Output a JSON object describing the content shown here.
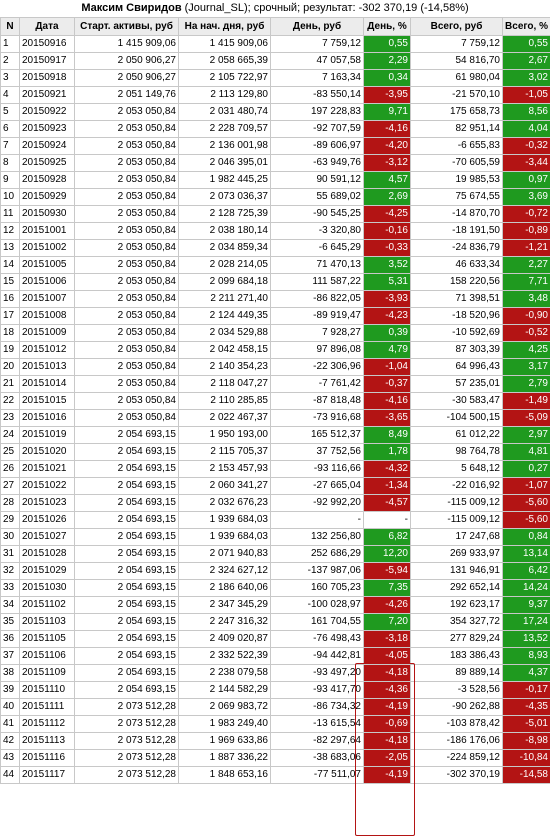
{
  "header": {
    "name": "Максим Свиридов",
    "rest": " (Journal_SL); срочный; результат: -302 370,19 (-14,58%)"
  },
  "columns": [
    "N",
    "Дата",
    "Старт. активы, руб",
    "На нач. дня, руб",
    "День, руб",
    "День, %",
    "Всего, руб",
    "Всего, %"
  ],
  "colors": {
    "positive": "#1f9a1f",
    "negative": "#b31414"
  },
  "rows": [
    [
      "1",
      "20150916",
      "1 415 909,06",
      "1 415 909,06",
      "7 759,12",
      "0,55",
      "7 759,12",
      "0,55"
    ],
    [
      "2",
      "20150917",
      "2 050 906,27",
      "2 058 665,39",
      "47 057,58",
      "2,29",
      "54 816,70",
      "2,67"
    ],
    [
      "3",
      "20150918",
      "2 050 906,27",
      "2 105 722,97",
      "7 163,34",
      "0,34",
      "61 980,04",
      "3,02"
    ],
    [
      "4",
      "20150921",
      "2 051 149,76",
      "2 113 129,80",
      "-83 550,14",
      "-3,95",
      "-21 570,10",
      "-1,05"
    ],
    [
      "5",
      "20150922",
      "2 053 050,84",
      "2 031 480,74",
      "197 228,83",
      "9,71",
      "175 658,73",
      "8,56"
    ],
    [
      "6",
      "20150923",
      "2 053 050,84",
      "2 228 709,57",
      "-92 707,59",
      "-4,16",
      "82 951,14",
      "4,04"
    ],
    [
      "7",
      "20150924",
      "2 053 050,84",
      "2 136 001,98",
      "-89 606,97",
      "-4,20",
      "-6 655,83",
      "-0,32"
    ],
    [
      "8",
      "20150925",
      "2 053 050,84",
      "2 046 395,01",
      "-63 949,76",
      "-3,12",
      "-70 605,59",
      "-3,44"
    ],
    [
      "9",
      "20150928",
      "2 053 050,84",
      "1 982 445,25",
      "90 591,12",
      "4,57",
      "19 985,53",
      "0,97"
    ],
    [
      "10",
      "20150929",
      "2 053 050,84",
      "2 073 036,37",
      "55 689,02",
      "2,69",
      "75 674,55",
      "3,69"
    ],
    [
      "11",
      "20150930",
      "2 053 050,84",
      "2 128 725,39",
      "-90 545,25",
      "-4,25",
      "-14 870,70",
      "-0,72"
    ],
    [
      "12",
      "20151001",
      "2 053 050,84",
      "2 038 180,14",
      "-3 320,80",
      "-0,16",
      "-18 191,50",
      "-0,89"
    ],
    [
      "13",
      "20151002",
      "2 053 050,84",
      "2 034 859,34",
      "-6 645,29",
      "-0,33",
      "-24 836,79",
      "-1,21"
    ],
    [
      "14",
      "20151005",
      "2 053 050,84",
      "2 028 214,05",
      "71 470,13",
      "3,52",
      "46 633,34",
      "2,27"
    ],
    [
      "15",
      "20151006",
      "2 053 050,84",
      "2 099 684,18",
      "111 587,22",
      "5,31",
      "158 220,56",
      "7,71"
    ],
    [
      "16",
      "20151007",
      "2 053 050,84",
      "2 211 271,40",
      "-86 822,05",
      "-3,93",
      "71 398,51",
      "3,48"
    ],
    [
      "17",
      "20151008",
      "2 053 050,84",
      "2 124 449,35",
      "-89 919,47",
      "-4,23",
      "-18 520,96",
      "-0,90"
    ],
    [
      "18",
      "20151009",
      "2 053 050,84",
      "2 034 529,88",
      "7 928,27",
      "0,39",
      "-10 592,69",
      "-0,52"
    ],
    [
      "19",
      "20151012",
      "2 053 050,84",
      "2 042 458,15",
      "97 896,08",
      "4,79",
      "87 303,39",
      "4,25"
    ],
    [
      "20",
      "20151013",
      "2 053 050,84",
      "2 140 354,23",
      "-22 306,96",
      "-1,04",
      "64 996,43",
      "3,17"
    ],
    [
      "21",
      "20151014",
      "2 053 050,84",
      "2 118 047,27",
      "-7 761,42",
      "-0,37",
      "57 235,01",
      "2,79"
    ],
    [
      "22",
      "20151015",
      "2 053 050,84",
      "2 110 285,85",
      "-87 818,48",
      "-4,16",
      "-30 583,47",
      "-1,49"
    ],
    [
      "23",
      "20151016",
      "2 053 050,84",
      "2 022 467,37",
      "-73 916,68",
      "-3,65",
      "-104 500,15",
      "-5,09"
    ],
    [
      "24",
      "20151019",
      "2 054 693,15",
      "1 950 193,00",
      "165 512,37",
      "8,49",
      "61 012,22",
      "2,97"
    ],
    [
      "25",
      "20151020",
      "2 054 693,15",
      "2 115 705,37",
      "37 752,56",
      "1,78",
      "98 764,78",
      "4,81"
    ],
    [
      "26",
      "20151021",
      "2 054 693,15",
      "2 153 457,93",
      "-93 116,66",
      "-4,32",
      "5 648,12",
      "0,27"
    ],
    [
      "27",
      "20151022",
      "2 054 693,15",
      "2 060 341,27",
      "-27 665,04",
      "-1,34",
      "-22 016,92",
      "-1,07"
    ],
    [
      "28",
      "20151023",
      "2 054 693,15",
      "2 032 676,23",
      "-92 992,20",
      "-4,57",
      "-115 009,12",
      "-5,60"
    ],
    [
      "29",
      "20151026",
      "2 054 693,15",
      "1 939 684,03",
      "-",
      "-",
      "-115 009,12",
      "-5,60"
    ],
    [
      "30",
      "20151027",
      "2 054 693,15",
      "1 939 684,03",
      "132 256,80",
      "6,82",
      "17 247,68",
      "0,84"
    ],
    [
      "31",
      "20151028",
      "2 054 693,15",
      "2 071 940,83",
      "252 686,29",
      "12,20",
      "269 933,97",
      "13,14"
    ],
    [
      "32",
      "20151029",
      "2 054 693,15",
      "2 324 627,12",
      "-137 987,06",
      "-5,94",
      "131 946,91",
      "6,42"
    ],
    [
      "33",
      "20151030",
      "2 054 693,15",
      "2 186 640,06",
      "160 705,23",
      "7,35",
      "292 652,14",
      "14,24"
    ],
    [
      "34",
      "20151102",
      "2 054 693,15",
      "2 347 345,29",
      "-100 028,97",
      "-4,26",
      "192 623,17",
      "9,37"
    ],
    [
      "35",
      "20151103",
      "2 054 693,15",
      "2 247 316,32",
      "161 704,55",
      "7,20",
      "354 327,72",
      "17,24"
    ],
    [
      "36",
      "20151105",
      "2 054 693,15",
      "2 409 020,87",
      "-76 498,43",
      "-3,18",
      "277 829,24",
      "13,52"
    ],
    [
      "37",
      "20151106",
      "2 054 693,15",
      "2 332 522,39",
      "-94 442,81",
      "-4,05",
      "183 386,43",
      "8,93"
    ],
    [
      "38",
      "20151109",
      "2 054 693,15",
      "2 238 079,58",
      "-93 497,20",
      "-4,18",
      "89 889,14",
      "4,37"
    ],
    [
      "39",
      "20151110",
      "2 054 693,15",
      "2 144 582,29",
      "-93 417,70",
      "-4,36",
      "-3 528,56",
      "-0,17"
    ],
    [
      "40",
      "20151111",
      "2 073 512,28",
      "2 069 983,72",
      "-86 734,32",
      "-4,19",
      "-90 262,88",
      "-4,35"
    ],
    [
      "41",
      "20151112",
      "2 073 512,28",
      "1 983 249,40",
      "-13 615,54",
      "-0,69",
      "-103 878,42",
      "-5,01"
    ],
    [
      "42",
      "20151113",
      "2 073 512,28",
      "1 969 633,86",
      "-82 297,64",
      "-4,18",
      "-186 176,06",
      "-8,98"
    ],
    [
      "43",
      "20151116",
      "2 073 512,28",
      "1 887 336,22",
      "-38 683,06",
      "-2,05",
      "-224 859,12",
      "-10,84"
    ],
    [
      "44",
      "20151117",
      "2 073 512,28",
      "1 848 653,16",
      "-77 511,07",
      "-4,19",
      "-302 370,19",
      "-14,58"
    ]
  ]
}
